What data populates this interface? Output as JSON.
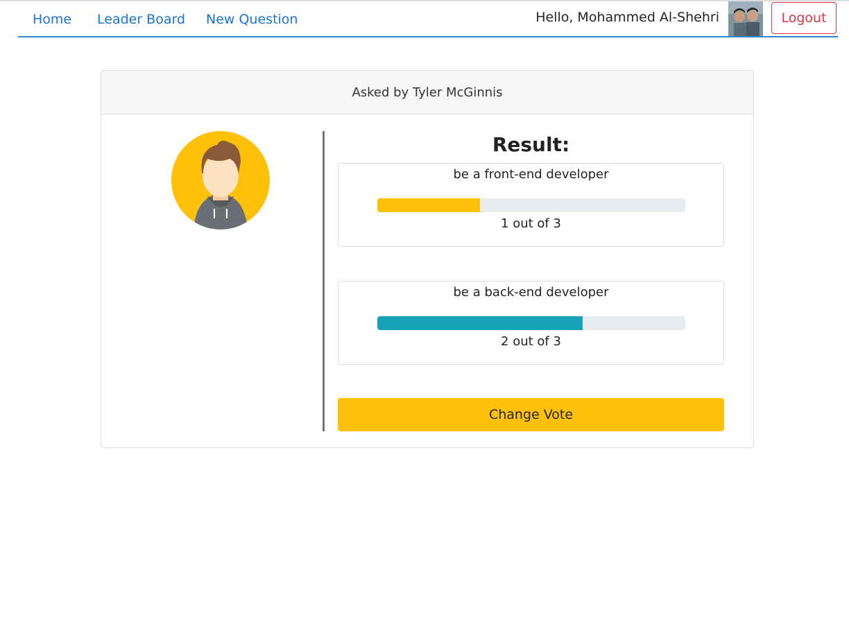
{
  "nav": {
    "links": [
      "Home",
      "Leader Board",
      "New Question"
    ],
    "greeting": "Hello, Mohammed Al-Shehri",
    "logout_label": "Logout"
  },
  "question": {
    "asked_by": "Asked by Tyler McGinnis",
    "result_title": "Result:",
    "options": [
      {
        "text": "be a front-end developer",
        "votes_text": "1 out of 3",
        "fraction": 0.3333,
        "color": "#ffc107"
      },
      {
        "text": "be a back-end developer",
        "votes_text": "2 out of 3",
        "fraction": 0.6667,
        "color": "#17a2b8"
      }
    ],
    "change_vote_label": "Change Vote"
  },
  "colors": {
    "nav_link": "#1a73d9",
    "nav_underline": "#2f86c8",
    "logout": "#dc3545",
    "accent_yellow": "#ffc107",
    "accent_teal": "#17a2b8"
  }
}
